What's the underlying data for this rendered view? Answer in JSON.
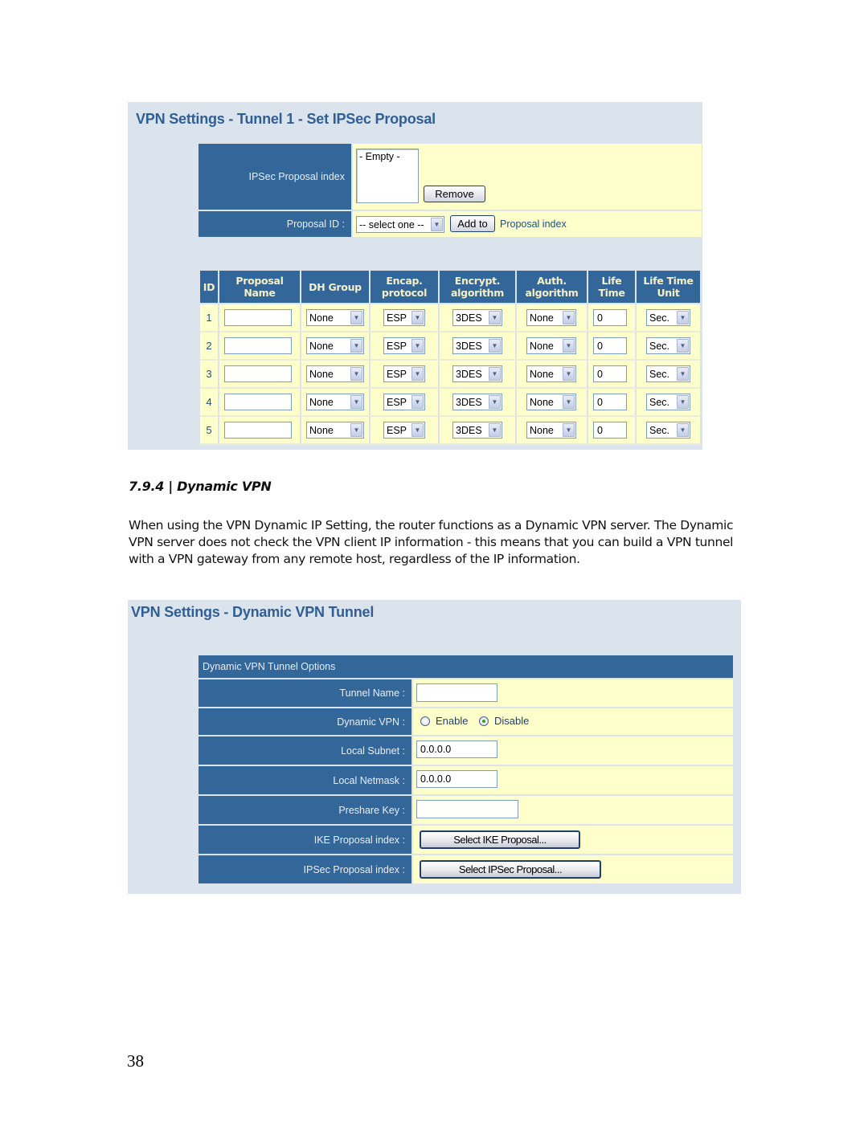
{
  "ipsec_panel": {
    "title": "VPN Settings - Tunnel 1 - Set IPSec Proposal",
    "proposal_index_label": "IPSec Proposal index",
    "proposal_index_list": [
      "- Empty -"
    ],
    "remove_button": "Remove",
    "proposal_id_label": "Proposal ID :",
    "proposal_id_select": "-- select one --",
    "add_to_button": "Add to",
    "add_to_suffix": "Proposal index",
    "table": {
      "columns": [
        "ID",
        "Proposal Name",
        "DH Group",
        "Encap. protocol",
        "Encrypt. algorithm",
        "Auth. algorithm",
        "Life Time",
        "Life Time Unit"
      ],
      "column_lines": [
        [
          "ID"
        ],
        [
          "Proposal",
          "Name"
        ],
        [
          "DH Group"
        ],
        [
          "Encap.",
          "protocol"
        ],
        [
          "Encrypt.",
          "algorithm"
        ],
        [
          "Auth.",
          "algorithm"
        ],
        [
          "Life",
          "Time"
        ],
        [
          "Life Time",
          "Unit"
        ]
      ],
      "rows": [
        {
          "id": "1",
          "name": "",
          "dh_group": "None",
          "encap": "ESP",
          "encrypt": "3DES",
          "auth": "None",
          "life_time": "0",
          "unit": "Sec."
        },
        {
          "id": "2",
          "name": "",
          "dh_group": "None",
          "encap": "ESP",
          "encrypt": "3DES",
          "auth": "None",
          "life_time": "0",
          "unit": "Sec."
        },
        {
          "id": "3",
          "name": "",
          "dh_group": "None",
          "encap": "ESP",
          "encrypt": "3DES",
          "auth": "None",
          "life_time": "0",
          "unit": "Sec."
        },
        {
          "id": "4",
          "name": "",
          "dh_group": "None",
          "encap": "ESP",
          "encrypt": "3DES",
          "auth": "None",
          "life_time": "0",
          "unit": "Sec."
        },
        {
          "id": "5",
          "name": "",
          "dh_group": "None",
          "encap": "ESP",
          "encrypt": "3DES",
          "auth": "None",
          "life_time": "0",
          "unit": "Sec."
        }
      ]
    }
  },
  "section": {
    "heading": "7.9.4 | Dynamic VPN",
    "paragraph": "When using the VPN Dynamic IP Setting, the router functions as a Dynamic VPN server. The Dynamic VPN server does not check the VPN client IP information - this means that you can build a VPN tunnel with a VPN gateway from any remote host, regardless of the IP information."
  },
  "dynamic_panel": {
    "title": "VPN Settings - Dynamic VPN Tunnel",
    "options_header": "Dynamic VPN Tunnel Options",
    "tunnel_name_label": "Tunnel Name :",
    "tunnel_name_value": "",
    "dynamic_vpn_label": "Dynamic VPN :",
    "enable_label": "Enable",
    "disable_label": "Disable",
    "dynamic_vpn_selected": "Disable",
    "local_subnet_label": "Local Subnet :",
    "local_subnet_value": "0.0.0.0",
    "local_netmask_label": "Local Netmask :",
    "local_netmask_value": "0.0.0.0",
    "preshare_key_label": "Preshare Key :",
    "preshare_key_value": "",
    "ike_label": "IKE Proposal index :",
    "ike_button": "Select IKE Proposal...",
    "ipsec_label": "IPSec Proposal index :",
    "ipsec_button": "Select IPSec Proposal..."
  },
  "colors": {
    "panel_bg": "#dbe3ec",
    "label_bg": "#336699",
    "value_bg": "#ffffcc",
    "title_color": "#2f5f95",
    "radio_dot": "#2aa52a"
  },
  "page_number": "38"
}
